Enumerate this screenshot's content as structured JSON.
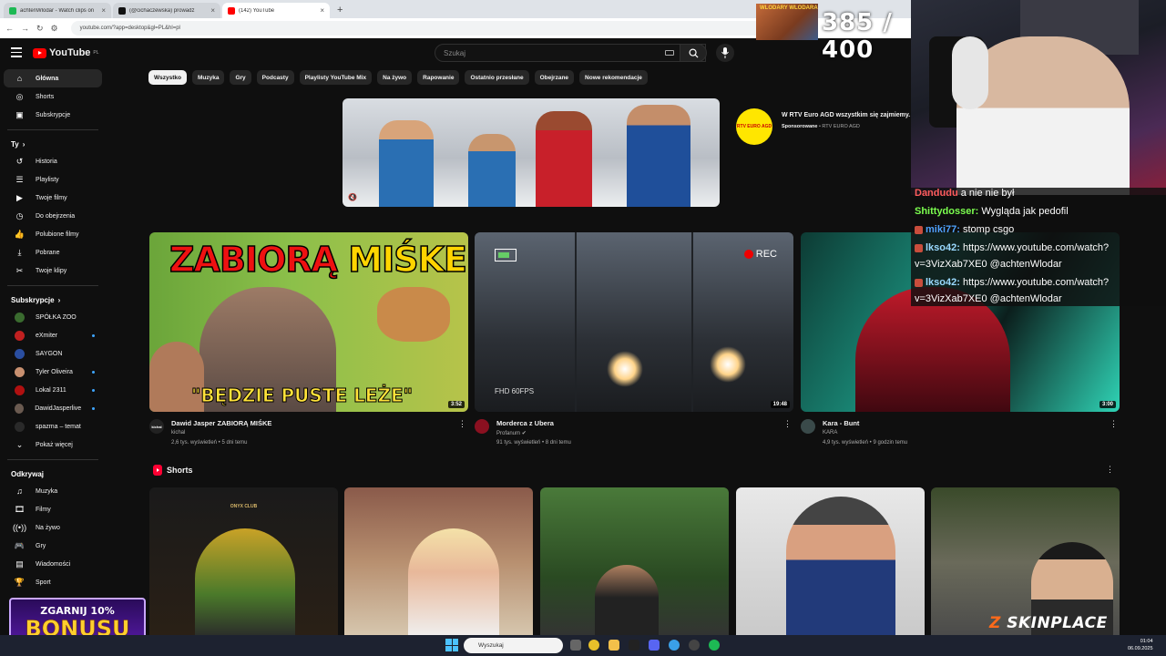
{
  "browser": {
    "tabs": [
      {
        "title": "achtenWlodar - Watch clips on",
        "color": "#1db954",
        "active": false
      },
      {
        "title": "(@cichaczewska) prowadź",
        "color": "#111111",
        "active": false
      },
      {
        "title": "(142) YouTube",
        "color": "#ff0000",
        "active": true
      }
    ],
    "url": "youtube.com/?app=desktop&gl=PL&hl=pl"
  },
  "overlay": {
    "score": "385 / 400",
    "score_banner": "WLODARY WLODARA",
    "bonus_line1": "ZGARNIJ 10%",
    "bonus_line2": "BONUSU",
    "brand": "SKINPLACE"
  },
  "chat": [
    {
      "user": "Dandudu",
      "text": "a nie nie był",
      "color": "#ff5c5c",
      "badge": false
    },
    {
      "user": "Shittydosser:",
      "text": "Wygląda jak pedofil",
      "color": "#7cff4f",
      "badge": false
    },
    {
      "user": "miki77:",
      "text": "stomp csgo",
      "color": "#4fa3ff",
      "badge": true
    },
    {
      "user": "lkso42:",
      "text": "https://www.youtube.com/watch?",
      "color": "#9ad9ff",
      "badge": true
    },
    {
      "user": "",
      "text": "v=3VizXab7XE0 @achtenWlodar",
      "color": "#ffffff",
      "badge": false
    },
    {
      "user": "lkso42:",
      "text": "https://www.youtube.com/watch?",
      "color": "#9ad9ff",
      "badge": true
    },
    {
      "user": "",
      "text": "v=3VizXab7XE0 @achtenWlodar",
      "color": "#ffffff",
      "badge": false
    }
  ],
  "youtube": {
    "logo": "YouTube",
    "region": "PL",
    "search_placeholder": "Szukaj",
    "sidebar_main": [
      {
        "label": "Główna",
        "icon": "home-icon",
        "glyph": "⌂"
      },
      {
        "label": "Shorts",
        "icon": "shorts-icon",
        "glyph": "◎"
      },
      {
        "label": "Subskrypcje",
        "icon": "subscriptions-icon",
        "glyph": "▣"
      }
    ],
    "you_header": "Ty",
    "sidebar_you": [
      {
        "label": "Historia",
        "icon": "history-icon",
        "glyph": "↺"
      },
      {
        "label": "Playlisty",
        "icon": "playlists-icon",
        "glyph": "☰"
      },
      {
        "label": "Twoje filmy",
        "icon": "your-videos-icon",
        "glyph": "▶"
      },
      {
        "label": "Do obejrzenia",
        "icon": "watch-later-icon",
        "glyph": "◷"
      },
      {
        "label": "Polubione filmy",
        "icon": "liked-icon",
        "glyph": "👍"
      },
      {
        "label": "Pobrane",
        "icon": "downloads-icon",
        "glyph": "⤓"
      },
      {
        "label": "Twoje klipy",
        "icon": "clips-icon",
        "glyph": "✂"
      }
    ],
    "subs_header": "Subskrypcje",
    "subscriptions": [
      {
        "label": "SPÓŁKA ZOO",
        "color": "#3a6b2f",
        "dot": false
      },
      {
        "label": "eXmiter",
        "color": "#c02020",
        "dot": true
      },
      {
        "label": "SAYGON",
        "color": "#2a4ea0",
        "dot": false
      },
      {
        "label": "Tyler Oliveira",
        "color": "#c89070",
        "dot": true
      },
      {
        "label": "Lokal 2311",
        "color": "#b01010",
        "dot": true
      },
      {
        "label": "DawidJasperlive",
        "color": "#6a5a50",
        "dot": true
      },
      {
        "label": "spazma – temat",
        "color": "#2a2a2a",
        "dot": false
      }
    ],
    "show_more": "Pokaż więcej",
    "explore_header": "Odkrywaj",
    "sidebar_explore": [
      {
        "label": "Muzyka",
        "icon": "music-icon",
        "glyph": "♫"
      },
      {
        "label": "Filmy",
        "icon": "movies-icon",
        "glyph": "🎞"
      },
      {
        "label": "Na żywo",
        "icon": "live-icon",
        "glyph": "((•))"
      },
      {
        "label": "Gry",
        "icon": "gaming-icon",
        "glyph": "🎮"
      },
      {
        "label": "Wiadomości",
        "icon": "news-icon",
        "glyph": "▤"
      },
      {
        "label": "Sport",
        "icon": "sport-icon",
        "glyph": "🏆"
      }
    ],
    "chips": [
      "Wszystko",
      "Muzyka",
      "Gry",
      "Podcasty",
      "Playlisty YouTube Mix",
      "Na żywo",
      "Rapowanie",
      "Ostatnio przesłane",
      "Obejrzane",
      "Nowe rekomendacje"
    ],
    "ad": {
      "title": "W RTV Euro AGD wszystkim się zajmiemy.",
      "sponsored": "Sponsorowane",
      "advertiser": "RTV EURO AGD",
      "logo_text": "RTV EURO AGD"
    },
    "videos": [
      {
        "title": "Dawid Jasper ZABIORĄ MIŚKE",
        "channel": "kichal",
        "stats": "2,6 tys. wyświetleń • 5 dni temu",
        "duration": "3:52",
        "thumb_text1a": "ZABIORĄ ",
        "thumb_text1b": "MIŚKE",
        "thumb_text2": "\"BĘDZIE PUSTE LEŻE\"",
        "avatar_text": "kichal",
        "avatar_color": "#222222"
      },
      {
        "title": "Morderca z Ubera",
        "channel": "Profanum",
        "stats": "91 tys. wyświetleń • 8 dni temu",
        "duration": "19:48",
        "rec": "REC",
        "fhd": "FHD 60FPS",
        "avatar_text": "",
        "avatar_color": "#8a1020"
      },
      {
        "title": "Kara - Bunt",
        "channel": "KARA",
        "stats": "4,9 tys. wyświetleń • 9 godzin temu",
        "duration": "3:00",
        "avatar_text": "",
        "avatar_color": "#3a4a4a"
      }
    ],
    "shorts_header": "Shorts",
    "shorts": [
      {
        "label": "ONYX CLUB"
      },
      {
        "label": ""
      },
      {
        "label": ""
      },
      {
        "label": ""
      },
      {
        "label": ""
      }
    ]
  },
  "taskbar": {
    "search": "Wyszukaj",
    "time": "01:04",
    "date": "06.09.2025"
  }
}
